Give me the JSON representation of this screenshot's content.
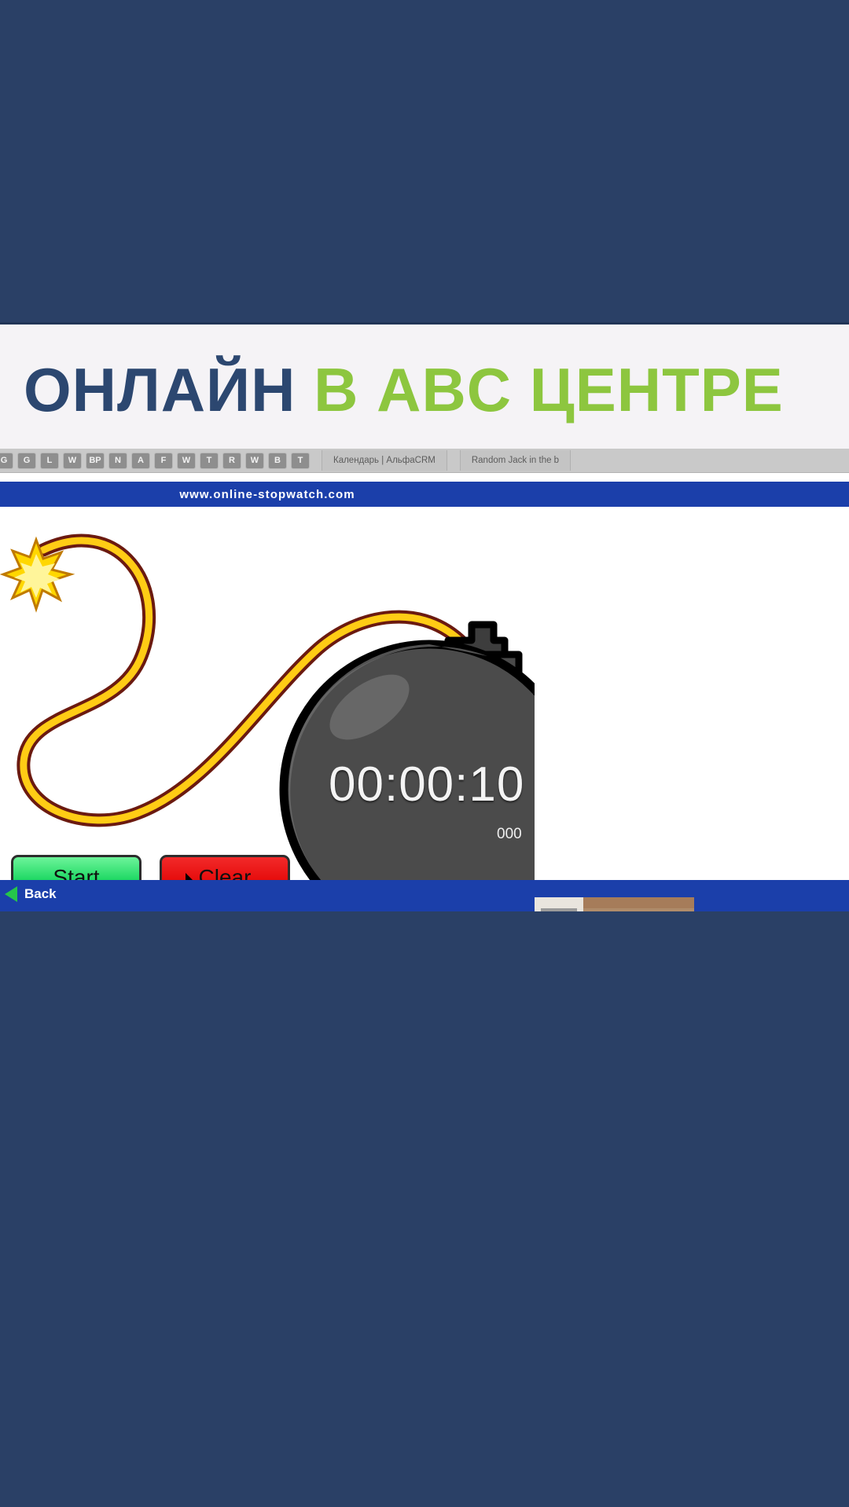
{
  "title_band": {
    "text_dark": "ОНЛАЙН",
    "text_green": "В ABC ЦЕНТРЕ",
    "color_dark": "#2c4770",
    "color_green": "#8dc63f"
  },
  "browser": {
    "favicon_tabs": [
      {
        "letter": "G"
      },
      {
        "letter": "G"
      },
      {
        "letter": "L"
      },
      {
        "letter": "W"
      },
      {
        "letter": "BP"
      },
      {
        "letter": "N"
      },
      {
        "letter": "A"
      },
      {
        "letter": "F"
      },
      {
        "letter": "W"
      },
      {
        "letter": "T"
      },
      {
        "letter": "R"
      },
      {
        "letter": "W"
      },
      {
        "letter": "B"
      },
      {
        "letter": "T"
      }
    ],
    "text_tabs": [
      {
        "label": "Календарь | АльфаCRM"
      },
      {
        "label": "Random Jack in the b"
      }
    ]
  },
  "stopwatch": {
    "site_url": "www.online-stopwatch.com",
    "timer_value": "00:00:10",
    "timer_milliseconds": "000",
    "start_label": "Start",
    "clear_label": "Clear",
    "back_label": "Back",
    "colors": {
      "header_blue": "#1b3faa",
      "start_green": "#1fd864",
      "clear_red": "#e60d0d",
      "fuse_yellow": "#ffcc15",
      "fuse_outline": "#6b1a10",
      "bomb_body": "#4a4a4a",
      "spark_yellow": "#ffd700"
    }
  },
  "video_panel": {
    "tiles": [
      {
        "name": "participant-1"
      },
      {
        "name": "participant-2"
      },
      {
        "name": "participant-3"
      },
      {
        "name": "participant-4"
      },
      {
        "name": "participant-5"
      }
    ]
  },
  "page": {
    "background_color": "#2a4066"
  }
}
